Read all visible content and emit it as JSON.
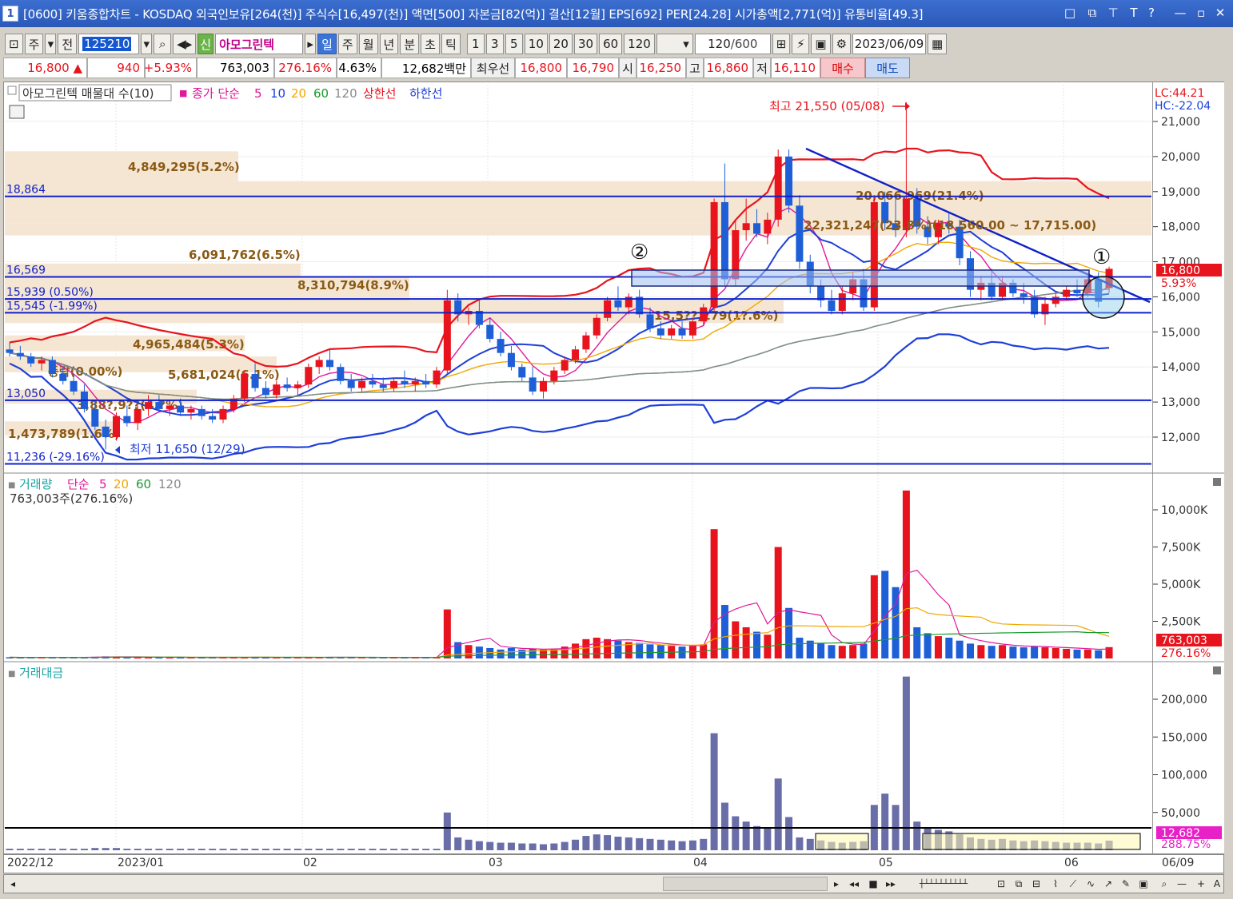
{
  "window": {
    "number": "1",
    "title": "[0600] 키움종합차트 - KOSDAQ 외국인보유[264(천)] 주식수[16,497(천)] 액면[500] 자본금[82(억)] 결산[12월] EPS[692] PER[24.28] 시가총액[2,771(억)] 유통비율[49.3]",
    "buttons": [
      "□",
      "⧉",
      "⊤",
      "T",
      "?",
      "—",
      "▫",
      "✕"
    ]
  },
  "toolbar": {
    "period_type": "주",
    "all": "전",
    "code": "125210",
    "name": "아모그린텍",
    "sin": "신",
    "periods": [
      "일",
      "주",
      "월",
      "년",
      "분",
      "초",
      "틱"
    ],
    "active_period": "일",
    "minutes": [
      "1",
      "3",
      "5",
      "10",
      "20",
      "30",
      "60",
      "120"
    ],
    "count": "120",
    "count_max": "/600",
    "date": "2023/06/09"
  },
  "price": {
    "current": "16,800 ▲",
    "change": "940",
    "change_rate": "+5.93%",
    "volume": "763,003",
    "volume_rate": "276.16%",
    "turnover": "4.63%",
    "amount": "12,682백만",
    "best_label": "최우선",
    "ask": "16,800",
    "bid": "16,790",
    "open_label": "시",
    "open": "16,250",
    "high_label": "고",
    "high": "16,860",
    "low_label": "저",
    "low": "16,110",
    "buy": "매수",
    "sell": "매도"
  },
  "price_panel": {
    "legend": {
      "title": "아모그린텍 매물대 수(10)",
      "ma_label": "종가 단순",
      "ma_periods": [
        "5",
        "10",
        "20",
        "60",
        "120"
      ],
      "ma_colors": [
        "#e0189a",
        "#1e3fd8",
        "#f0a800",
        "#1a9a2e",
        "#8a8a8a"
      ],
      "upper": "상한선",
      "lower": "하한선"
    },
    "lc": "LC:44.21",
    "hc": "HC:-22.04",
    "current_tag": "16,800",
    "current_rate": "5.93%",
    "high_note": "최고 21,550 (05/08)",
    "low_note": "최저 11,650 (12/29)",
    "marker1": "①",
    "marker2": "②",
    "hlines": [
      {
        "value": 18864,
        "label": "18,864"
      },
      {
        "value": 16569,
        "label": "16,569"
      },
      {
        "value": 15939,
        "label": "15,939 (0.50%)"
      },
      {
        "value": 15545,
        "label": "15,545 (-1.99%)"
      },
      {
        "value": 13050,
        "label": "13,050"
      },
      {
        "value": 11236,
        "label": "11,236 (-29.16%)"
      }
    ],
    "prediction_label": "22,321,247(23.8%)(18,560.00 ~ 17,715.00)",
    "volume_profile": [
      {
        "label": "4,849,295(5.2%)"
      },
      {
        "label": "20,066,969(21.4%)"
      },
      {
        "label": "6,091,762(6.5%)"
      },
      {
        "label": "8,310,794(8.9%)"
      },
      {
        "label": "15,5??,179(1?.6%)"
      },
      {
        "label": "4,965,484(5.3%)"
      },
      {
        "label": "5,681,024(6.1%)"
      },
      {
        "label": "1,473,789(1.6%)"
      },
      {
        "label": "등락(0.00%)"
      },
      {
        "label": "3,88?,9??(4.?%)"
      }
    ]
  },
  "volume_panel": {
    "legend_title": "거래량",
    "ma_label": "단순",
    "ma_periods": [
      "5",
      "20",
      "60",
      "120"
    ],
    "current": "763,003주(276.16%)",
    "tag_value": "763,003",
    "tag_rate": "276.16%"
  },
  "amount_panel": {
    "legend_title": "거래대금",
    "tag_value": "12,682",
    "tag_rate": "288.75%"
  },
  "dates": [
    "2022/12",
    "2023/01",
    "02",
    "03",
    "04",
    "05",
    "06",
    "06/09"
  ],
  "chart_data": {
    "type": "candlestick",
    "series": [
      {
        "name": "일",
        "ohlc": [
          [
            14500,
            14700,
            14300,
            14400
          ],
          [
            14400,
            14600,
            14200,
            14300
          ],
          [
            14300,
            14400,
            14000,
            14100
          ],
          [
            14100,
            14300,
            13900,
            14200
          ],
          [
            14200,
            14300,
            13700,
            13800
          ],
          [
            13800,
            14000,
            13500,
            13600
          ],
          [
            13600,
            13800,
            13200,
            13300
          ],
          [
            13300,
            13500,
            12700,
            12800
          ],
          [
            12800,
            13000,
            12200,
            12300
          ],
          [
            12300,
            12500,
            11650,
            12000
          ],
          [
            12000,
            12700,
            11900,
            12600
          ],
          [
            12600,
            12900,
            12300,
            12400
          ],
          [
            12400,
            12900,
            12200,
            12800
          ],
          [
            12800,
            13200,
            12600,
            13000
          ],
          [
            13000,
            13200,
            12700,
            12800
          ],
          [
            12800,
            13000,
            12600,
            12900
          ],
          [
            12900,
            13100,
            12600,
            12700
          ],
          [
            12700,
            12900,
            12500,
            12800
          ],
          [
            12800,
            12900,
            12500,
            12600
          ],
          [
            12600,
            12800,
            12400,
            12500
          ],
          [
            12500,
            12900,
            12400,
            12800
          ],
          [
            12800,
            13200,
            12700,
            13100
          ],
          [
            13100,
            13900,
            13000,
            13800
          ],
          [
            13800,
            14100,
            13300,
            13400
          ],
          [
            13400,
            13600,
            13100,
            13200
          ],
          [
            13200,
            13600,
            13100,
            13500
          ],
          [
            13500,
            13700,
            13300,
            13400
          ],
          [
            13400,
            13600,
            13200,
            13500
          ],
          [
            13500,
            14100,
            13400,
            14000
          ],
          [
            14000,
            14300,
            13800,
            14200
          ],
          [
            14200,
            14500,
            13900,
            14000
          ],
          [
            14000,
            14100,
            13500,
            13600
          ],
          [
            13600,
            13800,
            13300,
            13400
          ],
          [
            13400,
            13700,
            13300,
            13600
          ],
          [
            13600,
            13800,
            13400,
            13500
          ],
          [
            13500,
            13700,
            13300,
            13400
          ],
          [
            13400,
            13700,
            13300,
            13600
          ],
          [
            13600,
            13900,
            13400,
            13500
          ],
          [
            13500,
            13700,
            13300,
            13600
          ],
          [
            13600,
            13800,
            13400,
            13500
          ],
          [
            13500,
            14000,
            13400,
            13900
          ],
          [
            13900,
            16200,
            13800,
            15900
          ],
          [
            15900,
            16100,
            15300,
            15500
          ],
          [
            15500,
            15700,
            15200,
            15600
          ],
          [
            15600,
            15900,
            15100,
            15200
          ],
          [
            15200,
            15400,
            14700,
            14800
          ],
          [
            14800,
            15000,
            14300,
            14400
          ],
          [
            14400,
            14600,
            13900,
            14000
          ],
          [
            14000,
            14100,
            13600,
            13700
          ],
          [
            13700,
            14000,
            13200,
            13300
          ],
          [
            13300,
            13700,
            13100,
            13600
          ],
          [
            13600,
            14000,
            13500,
            13900
          ],
          [
            13900,
            14300,
            13800,
            14200
          ],
          [
            14200,
            14600,
            14100,
            14500
          ],
          [
            14500,
            15000,
            14400,
            14900
          ],
          [
            14900,
            15500,
            14800,
            15400
          ],
          [
            15400,
            16000,
            15300,
            15900
          ],
          [
            15900,
            16300,
            15600,
            15700
          ],
          [
            15700,
            16100,
            15500,
            16000
          ],
          [
            16000,
            16200,
            15400,
            15500
          ],
          [
            15500,
            15700,
            15000,
            15100
          ],
          [
            15100,
            15300,
            14800,
            14900
          ],
          [
            14900,
            15200,
            14800,
            15100
          ],
          [
            15100,
            15300,
            14800,
            14900
          ],
          [
            14900,
            15400,
            14800,
            15300
          ],
          [
            15300,
            15800,
            15200,
            15700
          ],
          [
            15700,
            18800,
            15600,
            18700
          ],
          [
            18700,
            19800,
            16300,
            16500
          ],
          [
            16500,
            18200,
            16300,
            17900
          ],
          [
            17900,
            18800,
            17600,
            18100
          ],
          [
            18100,
            18500,
            17700,
            17800
          ],
          [
            17800,
            18400,
            17500,
            18200
          ],
          [
            18200,
            20200,
            18000,
            20000
          ],
          [
            20000,
            20200,
            18400,
            18600
          ],
          [
            18600,
            18900,
            16800,
            17000
          ],
          [
            17000,
            17200,
            16100,
            16300
          ],
          [
            16300,
            16500,
            15700,
            15900
          ],
          [
            15900,
            16200,
            15500,
            15600
          ],
          [
            15600,
            16300,
            15500,
            16100
          ],
          [
            16100,
            16700,
            15900,
            16500
          ],
          [
            16500,
            16800,
            15600,
            15700
          ],
          [
            15700,
            18900,
            15600,
            18700
          ],
          [
            18700,
            19000,
            17900,
            18100
          ],
          [
            18100,
            18900,
            17700,
            17900
          ],
          [
            17900,
            21550,
            17700,
            18800
          ],
          [
            18800,
            19100,
            17800,
            18000
          ],
          [
            18000,
            18300,
            17500,
            17700
          ],
          [
            17700,
            18200,
            17500,
            18100
          ],
          [
            18100,
            18400,
            17800,
            18000
          ],
          [
            18000,
            18200,
            16900,
            17100
          ],
          [
            17100,
            17300,
            16000,
            16200
          ],
          [
            16200,
            16600,
            15900,
            16400
          ],
          [
            16400,
            16800,
            15900,
            16000
          ],
          [
            16000,
            16600,
            15900,
            16400
          ],
          [
            16400,
            16500,
            16000,
            16100
          ],
          [
            16100,
            16400,
            15800,
            16000
          ],
          [
            16000,
            16200,
            15400,
            15500
          ],
          [
            15500,
            16000,
            15200,
            15800
          ],
          [
            15800,
            16100,
            15700,
            16000
          ],
          [
            16000,
            16300,
            15900,
            16200
          ],
          [
            16200,
            16500,
            16000,
            16100
          ],
          [
            16100,
            16600,
            16000,
            16500
          ],
          [
            16500,
            16700,
            15700,
            15860
          ],
          [
            16250,
            16860,
            16110,
            16800
          ]
        ]
      },
      {
        "name": "거래량",
        "values": [
          80,
          70,
          60,
          60,
          70,
          80,
          70,
          90,
          110,
          140,
          120,
          90,
          80,
          90,
          80,
          70,
          70,
          70,
          60,
          60,
          70,
          80,
          90,
          90,
          60,
          60,
          60,
          70,
          90,
          80,
          90,
          80,
          70,
          60,
          60,
          60,
          60,
          60,
          60,
          60,
          70,
          3300,
          1100,
          900,
          800,
          700,
          600,
          700,
          600,
          650,
          600,
          650,
          800,
          1000,
          1300,
          1400,
          1300,
          1200,
          1100,
          1050,
          950,
          900,
          850,
          800,
          850,
          950,
          8700,
          3600,
          2500,
          2100,
          1800,
          1600,
          7500,
          3400,
          1400,
          1200,
          1000,
          900,
          850,
          900,
          1000,
          5600,
          5900,
          4800,
          11300,
          2100,
          1700,
          1500,
          1400,
          1200,
          1000,
          900,
          850,
          900,
          800,
          750,
          800,
          750,
          700,
          650,
          600,
          600,
          550,
          763
        ]
      },
      {
        "name": "거래대금",
        "values": [
          2,
          2,
          2,
          2,
          2,
          2,
          2,
          2,
          3,
          3,
          3,
          2,
          2,
          2,
          2,
          2,
          2,
          2,
          2,
          2,
          2,
          2,
          2,
          2,
          2,
          2,
          2,
          2,
          2,
          2,
          2,
          2,
          2,
          2,
          2,
          2,
          2,
          2,
          2,
          2,
          2,
          50,
          17,
          14,
          12,
          11,
          10,
          10,
          9,
          9,
          8,
          9,
          11,
          14,
          19,
          21,
          20,
          18,
          17,
          16,
          15,
          14,
          13,
          12,
          13,
          15,
          155,
          63,
          45,
          38,
          32,
          29,
          95,
          44,
          17,
          15,
          13,
          11,
          10,
          11,
          12,
          60,
          75,
          60,
          230,
          38,
          30,
          27,
          25,
          21,
          17,
          15,
          14,
          15,
          13,
          12,
          13,
          12,
          11,
          10,
          10,
          10,
          9,
          12.7
        ]
      }
    ]
  }
}
